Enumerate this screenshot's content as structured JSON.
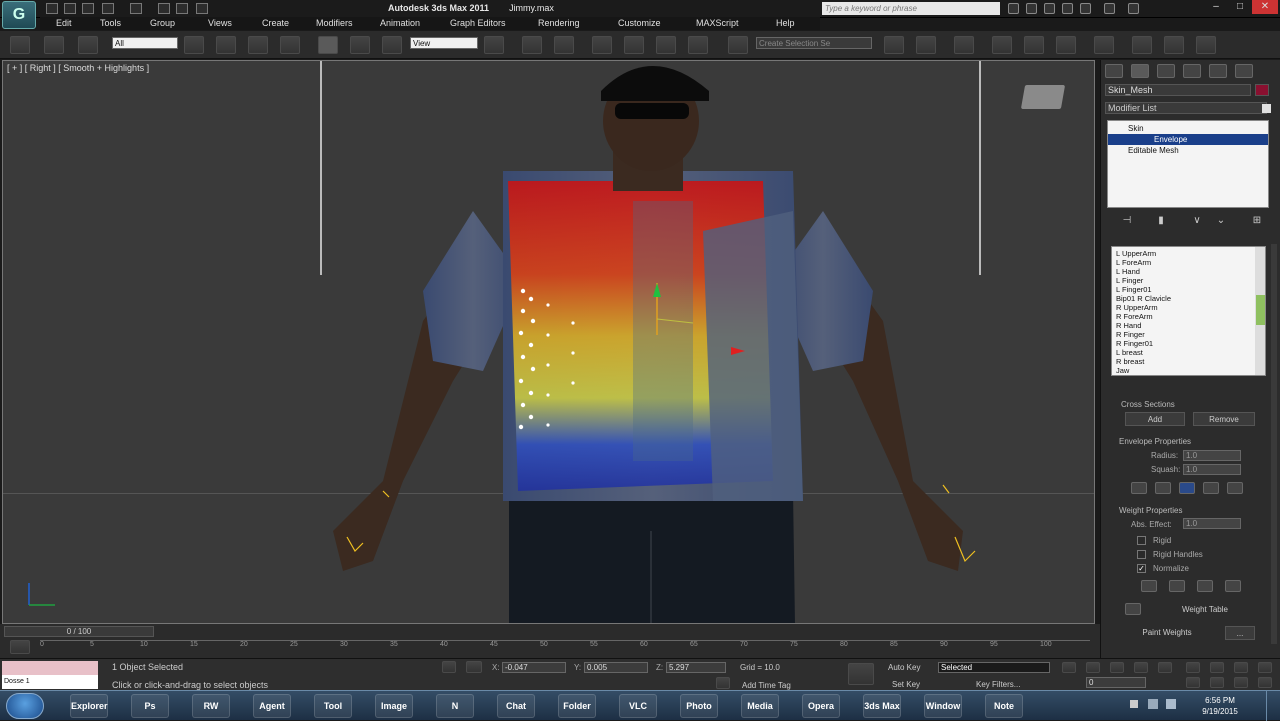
{
  "window": {
    "app_title": "Autodesk 3ds Max  2011",
    "file_name": "Jimmy.max",
    "search_placeholder": "Type a keyword or phrase",
    "app_icon_letter": "G"
  },
  "menu": [
    "Edit",
    "Tools",
    "Group",
    "Views",
    "Create",
    "Modifiers",
    "Animation",
    "Graph Editors",
    "Rendering",
    "Customize",
    "MAXScript",
    "Help"
  ],
  "toolbar": {
    "selection_filter": "All",
    "reference_coord": "View",
    "named_selection": "Create Selection Se"
  },
  "viewport": {
    "label": "[ + ] [ Right ] [ Smooth + Highlights ]"
  },
  "command_panel": {
    "object_name": "Skin_Mesh",
    "object_color": "#8a1030",
    "modifier_list_label": "Modifier List",
    "stack": [
      "Skin",
      "Envelope",
      "Editable Mesh"
    ],
    "bones": [
      "L UpperArm",
      "L ForeArm",
      "L Hand",
      "L Finger",
      "L Finger01",
      "Bip01 R Clavicle",
      "R UpperArm",
      "R ForeArm",
      "R Hand",
      "R Finger",
      "R Finger01",
      "L breast",
      "R breast",
      "Jaw"
    ],
    "cross_sections": {
      "title": "Cross Sections",
      "add": "Add",
      "remove": "Remove"
    },
    "envelope_properties": {
      "title": "Envelope Properties",
      "radius_label": "Radius:",
      "radius_value": "1.0",
      "squash_label": "Squash:",
      "squash_value": "1.0"
    },
    "weight_properties": {
      "title": "Weight Properties",
      "abs_effect_label": "Abs. Effect:",
      "abs_effect_value": "1.0",
      "rigid": "Rigid",
      "rigid_handles": "Rigid Handles",
      "normalize": "Normalize",
      "weight_table": "Weight Table",
      "paint_weights": "Paint Weights",
      "ellipsis": "..."
    }
  },
  "timeline": {
    "frame_display": "0 / 100",
    "ticks": [
      "0",
      "5",
      "10",
      "15",
      "20",
      "25",
      "30",
      "35",
      "40",
      "45",
      "50",
      "55",
      "60",
      "65",
      "70",
      "75",
      "80",
      "85",
      "90",
      "95",
      "100"
    ]
  },
  "status": {
    "script_listener": "Dosse 1",
    "selection_count": "1 Object Selected",
    "prompt": "Click or click-and-drag to select objects",
    "x_label": "X:",
    "x_value": "-0.047",
    "y_label": "Y:",
    "y_value": "0.005",
    "z_label": "Z:",
    "z_value": "5.297",
    "grid": "Grid = 10.0",
    "add_time_tag": "Add Time Tag",
    "auto_key": "Auto Key",
    "set_key": "Set Key",
    "key_mode": "Selected",
    "key_filters": "Key Filters...",
    "frame_value": "0"
  },
  "taskbar": {
    "apps": [
      "Explorer",
      "Ps",
      "RW",
      "Agent",
      "Tool",
      "Image",
      "N",
      "Chat",
      "Folder",
      "VLC",
      "Photo",
      "Media",
      "Opera",
      "3ds Max",
      "Window",
      "Note"
    ],
    "time": "6:56 PM",
    "date": "9/19/2015"
  }
}
